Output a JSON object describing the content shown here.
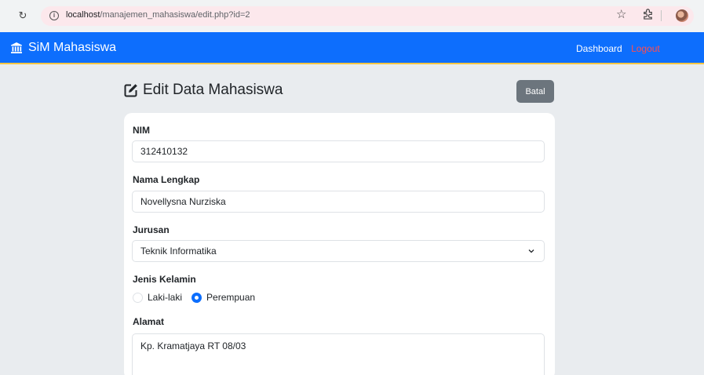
{
  "browser": {
    "url_host": "localhost",
    "url_path": "/manajemen_mahasiswa/edit.php?id=2"
  },
  "navbar": {
    "brand": "SiM Mahasiswa",
    "dashboard_label": "Dashboard",
    "logout_label": "Logout",
    "color": "#0d6efd"
  },
  "page": {
    "title": "Edit Data Mahasiswa",
    "cancel_label": "Batal"
  },
  "form": {
    "nim_label": "NIM",
    "nim_value": "312410132",
    "nama_label": "Nama Lengkap",
    "nama_value": "Novellysna Nurziska",
    "jurusan_label": "Jurusan",
    "jurusan_value": "Teknik Informatika",
    "gender_label": "Jenis Kelamin",
    "gender_options": [
      {
        "label": "Laki-laki",
        "selected": false
      },
      {
        "label": "Perempuan",
        "selected": true
      }
    ],
    "alamat_label": "Alamat",
    "alamat_value": "Kp. Kramatjaya RT 08/03"
  }
}
